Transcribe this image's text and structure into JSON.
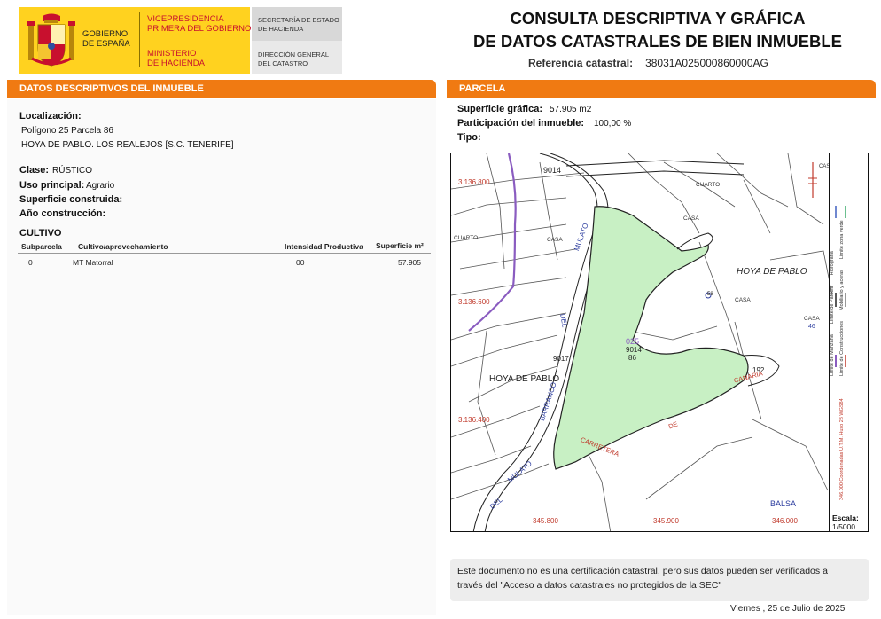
{
  "header": {
    "gobierno": [
      "GOBIERNO",
      "DE ESPAÑA"
    ],
    "vicepresidencia": [
      "VICEPRESIDENCIA",
      "PRIMERA DEL GOBIERNO"
    ],
    "ministerio": [
      "MINISTERIO",
      "DE HACIENDA"
    ],
    "secretaria": [
      "SECRETARÍA DE ESTADO",
      "DE HACIENDA"
    ],
    "direccion": [
      "DIRECCIÓN GENERAL",
      "DEL CATASTRO"
    ],
    "title_line1": "CONSULTA DESCRIPTIVA Y GRÁFICA",
    "title_line2": "DE DATOS CATASTRALES DE BIEN INMUEBLE",
    "ref_label": "Referencia catastral:",
    "ref_value": "38031A025000860000AG"
  },
  "left": {
    "section_title": "DATOS DESCRIPTIVOS DEL INMUEBLE",
    "localizacion_label": "Localización:",
    "localizacion_line1": "Polígono 25 Parcela 86",
    "localizacion_line2": "HOYA DE PABLO. LOS REALEJOS [S.C. TENERIFE]",
    "clase_label": "Clase:",
    "clase_value": "RÚSTICO",
    "uso_label": "Uso principal:",
    "uso_value": "Agrario",
    "superficie_label": "Superficie construida:",
    "anio_label": "Año construcción:",
    "cultivo_title": "CULTIVO",
    "table": {
      "headers": [
        "Subparcela",
        "Cultivo/aprovechamiento",
        "Intensidad Productiva",
        "Superficie m²"
      ],
      "rows": [
        [
          "0",
          "MT Matorral",
          "00",
          "57.905"
        ]
      ]
    }
  },
  "right": {
    "section_title": "PARCELA",
    "superficie_grafica_label": "Superficie gráfica:",
    "superficie_grafica_value": "57.905 m2",
    "participacion_label": "Participación del inmueble:",
    "participacion_value": "100,00 %",
    "tipo_label": "Tipo:"
  },
  "map": {
    "colors": {
      "parcel_fill": "#c8f0c4",
      "boundary_purple": "#8a5cc0",
      "coord_red": "#c0392b",
      "road_blue": "#3040a0"
    },
    "labels": {
      "top_road": "9014",
      "cuarto_top": "CUARTO",
      "casa_1": "CASA",
      "cuarto_left": "CUARTO",
      "casa_2": "CASA",
      "mulato_upper": "MULATO",
      "hoya_right": "HOYA DE PABLO",
      "casa_3": "CASA",
      "casa_4": "CASA",
      "num_46": "46",
      "del_upper": "DEL",
      "parcel_025": "025",
      "parcel_9014": "9014",
      "parcel_86": "86",
      "num_9017": "9017",
      "num_192": "192",
      "hoya_left": "HOYA DE PABLO",
      "barranco": "BARRANCO",
      "canaria": "CANARIA",
      "de_road": "DE",
      "carretera": "CARRETERA",
      "mulato_lower": "MULATO",
      "del_lower": "DEL",
      "balsa": "BALSA",
      "casa_topright": "CAS",
      "y_3136800": "3.136.800",
      "y_3136600": "3.136.600",
      "y_3136400": "3.136.400",
      "x_345800": "345.800",
      "x_345900": "345.900",
      "x_346000": "346.000",
      "num_58": "58"
    },
    "legend": {
      "col1": [
        "Límite de Manzana",
        "Límite de Parcela",
        "Hidrografía"
      ],
      "col2": [
        "Límite de Construcciones",
        "Mobiliario y aceras",
        "Límite zona verde"
      ],
      "coord_system": "346.000 Coordenadas U.T.M. Huso 28 WGS84"
    },
    "scale_label": "Escala:",
    "scale_value": "1/5000"
  },
  "footer": {
    "notice_line1": "Este documento no es una certificación catastral, pero sus datos pueden ser verificados a",
    "notice_line2": "través del \"Acceso a datos catastrales no protegidos de la SEC\"",
    "date": "Viernes , 25 de Julio de 2025"
  }
}
